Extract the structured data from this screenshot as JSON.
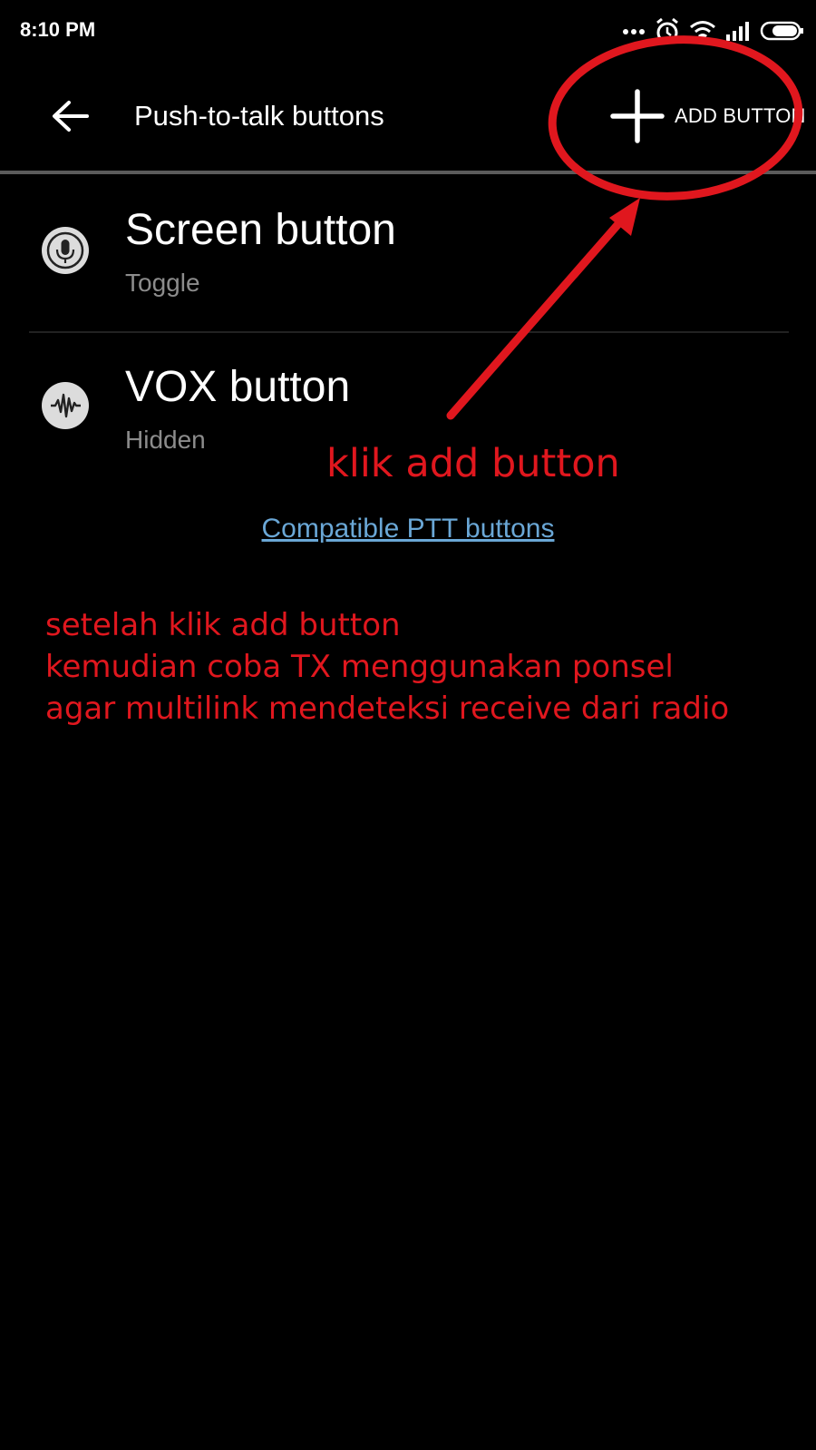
{
  "status_bar": {
    "time": "8:10 PM",
    "icons": [
      "more-dots-icon",
      "alarm-icon",
      "wifi-icon",
      "signal-icon",
      "battery-icon"
    ]
  },
  "app_bar": {
    "title": "Push-to-talk buttons",
    "back_icon": "back-arrow-icon",
    "add_button_label": "ADD BUTTON",
    "add_icon": "plus-icon"
  },
  "list": {
    "items": [
      {
        "title": "Screen button",
        "subtitle": "Toggle",
        "icon": "microphone-icon"
      },
      {
        "title": "VOX button",
        "subtitle": "Hidden",
        "icon": "waveform-icon"
      }
    ]
  },
  "compatible_link": "Compatible PTT buttons",
  "annotations": {
    "arrow_note": "klik add button",
    "instructions": [
      "setelah klik add button",
      "kemudian coba TX menggunakan ponsel",
      "agar multilink mendeteksi receive dari radio"
    ],
    "color": "#e0171e"
  },
  "colors": {
    "background": "#000000",
    "text_primary": "#ffffff",
    "text_secondary": "#8c8c8c",
    "link": "#6aa7d6",
    "divider": "#5b5b5b"
  }
}
